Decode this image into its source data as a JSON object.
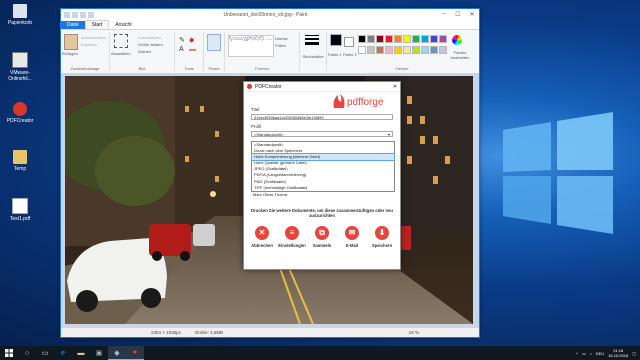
{
  "desktop": {
    "icons": [
      {
        "label": "Papierkorb",
        "icon": "recycle-bin-icon"
      },
      {
        "label": "VMware-Onlinehil...",
        "icon": "vmware-icon"
      },
      {
        "label": "PDFCreator",
        "icon": "pdfcreator-icon"
      },
      {
        "label": "Temp",
        "icon": "folder-icon"
      },
      {
        "label": "Test1.pdf",
        "icon": "pdf-file-icon"
      }
    ]
  },
  "paint": {
    "title": "Unbenannt_dsc00nnnn_ed.jpg - Paint",
    "tabs": {
      "file": "Datei",
      "start": "Start",
      "view": "Ansicht"
    },
    "ribbon": {
      "clipboard": {
        "paste": "Einfügen",
        "cut": "Ausschneiden",
        "copy": "Kopieren",
        "label": "Zwischenablage"
      },
      "image": {
        "select": "Auswählen",
        "crop": "Zuschneiden",
        "resize": "Größe ändern",
        "rotate": "Drehen",
        "label": "Bild"
      },
      "tools": {
        "label": "Tools"
      },
      "brushes": {
        "label": "Pinsel"
      },
      "shapes": {
        "outline": "Umriss",
        "fill": "Füllen",
        "label": "Formen"
      },
      "size": {
        "label": "Strichstärke"
      },
      "color1": "Farbe 1",
      "color2": "Farbe 2",
      "edit_colors": "Farben bearbeiten",
      "colors_label": "Farben",
      "palette": [
        "#000000",
        "#7f7f7f",
        "#880015",
        "#ed1c24",
        "#ff7f27",
        "#fff200",
        "#22b14c",
        "#00a2e8",
        "#3f48cc",
        "#a349a4",
        "#ffffff",
        "#c3c3c3",
        "#b97a57",
        "#ffaec9",
        "#ffc90e",
        "#efe4b0",
        "#b5e61d",
        "#99d9ea",
        "#7092be",
        "#c8bfe7"
      ]
    },
    "status": {
      "dimensions": "2304 × 1536px",
      "size": "Größe: 4,6MB",
      "zoom": "18 %"
    }
  },
  "pdfcreator": {
    "title": "PDFCreator",
    "brand": "pdfforge",
    "title_label": "Titel",
    "title_value": "01eecf0456aa1cb20080d56e1fe1f4899",
    "profile_label": "Profil",
    "profile_selected": "<Standardprofil>",
    "profile_options": [
      "<Standardprofil>",
      "Druck nach dem Speichern",
      "Hohe Komprimierung (kleinere Datei)",
      "Hohe Qualität (größere Datei)",
      "JPEG (Grafikdatei)",
      "PDF/A (Langzeitarchivierung)",
      "PNG (Grafikdatei)",
      "TIFF (mehrseitige Grafikdatei)"
    ],
    "profile_hover_index": 2,
    "author_value": "Marc Oliver Thoma",
    "hint": "Drucken Sie weitere Dokumente, um diese zusammenzufügen oder neu auszurichten",
    "actions": [
      {
        "label": "Abbrechen",
        "icon": "cancel-icon"
      },
      {
        "label": "Einstellungen",
        "icon": "settings-icon"
      },
      {
        "label": "Sammeln",
        "icon": "merge-icon"
      },
      {
        "label": "E-Mail",
        "icon": "email-icon"
      },
      {
        "label": "Speichern",
        "icon": "save-icon"
      }
    ]
  },
  "taskbar": {
    "time": "21:18",
    "date": "16.10.2016",
    "lang": "DEU"
  }
}
